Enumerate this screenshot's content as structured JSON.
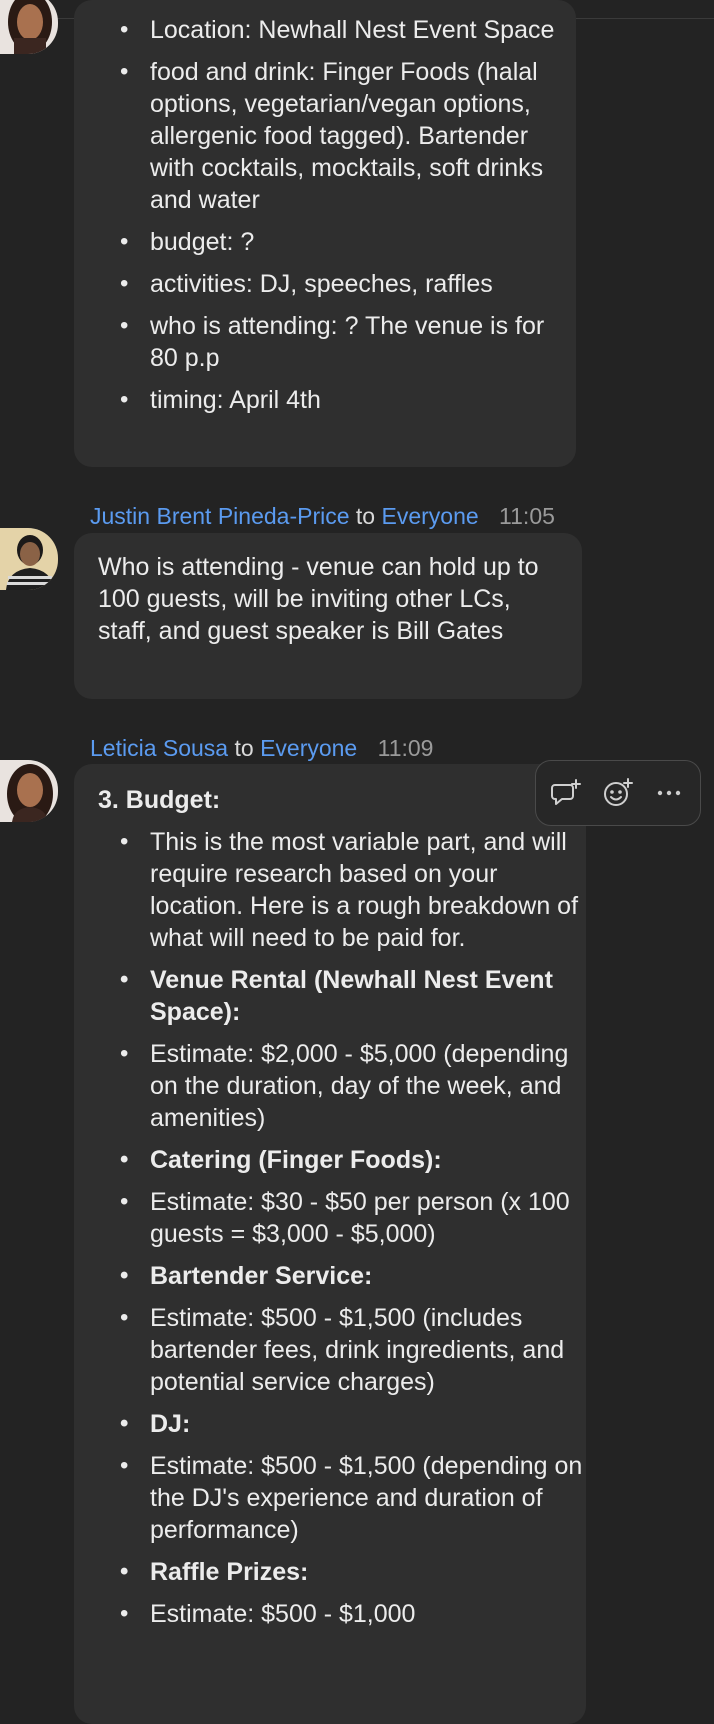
{
  "message1": {
    "items": [
      "Location: Newhall Nest Event Space",
      "food and drink: Finger Foods (halal options, vegetarian/vegan options, allergenic food tagged). Bartender with cocktails, mocktails, soft drinks and water",
      "budget: ?",
      "activities: DJ, speeches, raffles",
      "who is attending: ? The venue is for 80 p.p",
      "timing: April 4th"
    ]
  },
  "message2": {
    "sender": "Justin Brent Pineda-Price",
    "to_word": "to",
    "recipient": "Everyone",
    "time": "11:05",
    "text": "Who is attending - venue can hold up to 100 guests, will be inviting other LCs, staff, and guest speaker is Bill Gates"
  },
  "message3": {
    "sender": "Leticia Sousa",
    "to_word": "to",
    "recipient": "Everyone",
    "time": "11:09",
    "heading": "3. Budget:",
    "items": [
      {
        "text": "This is the most variable part, and will require research based on your location. Here is a rough breakdown of what will need to be paid for.",
        "bold": false
      },
      {
        "text": "Venue Rental (Newhall Nest Event Space):",
        "bold": true
      },
      {
        "text": "Estimate: $2,000 - $5,000 (depending on the duration, day of the week, and amenities)",
        "bold": false
      },
      {
        "text": "Catering (Finger Foods):",
        "bold": true
      },
      {
        "text": "Estimate: $30 - $50 per person (x 100 guests = $3,000 - $5,000)",
        "bold": false
      },
      {
        "text": "Bartender Service:",
        "bold": true
      },
      {
        "text": "Estimate: $500 - $1,500 (includes bartender fees, drink ingredients, and potential service charges)",
        "bold": false
      },
      {
        "text": "DJ:",
        "bold": true
      },
      {
        "text": "Estimate: $500 - $1,500 (depending on the DJ's experience and duration of performance)",
        "bold": false
      },
      {
        "text": "Raffle Prizes:",
        "bold": true
      },
      {
        "text": "Estimate: $500 - $1,000",
        "bold": false
      }
    ]
  },
  "hover_toolbar": {
    "icons": [
      "reply-in-thread-icon",
      "add-reaction-icon",
      "more-options-icon"
    ]
  }
}
